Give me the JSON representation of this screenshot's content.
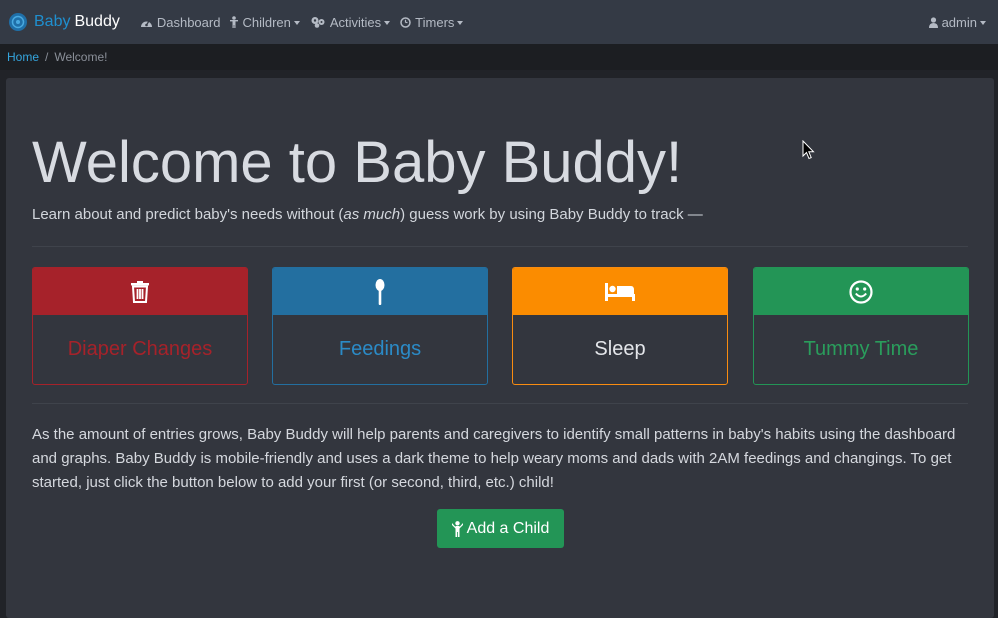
{
  "nav": {
    "brand_first": "Baby",
    "brand_second": "Buddy",
    "items": [
      {
        "label": "Dashboard",
        "icon": "dashboard-icon"
      },
      {
        "label": "Children",
        "icon": "child-icon"
      },
      {
        "label": "Activities",
        "icon": "activities-icon"
      },
      {
        "label": "Timers",
        "icon": "timer-icon"
      }
    ],
    "user": {
      "label": "admin",
      "icon": "user-icon"
    }
  },
  "breadcrumb": {
    "home": "Home",
    "separator": "/",
    "current": "Welcome!"
  },
  "main": {
    "title": "Welcome to Baby Buddy!",
    "lead_before": "Learn about and predict baby's needs without (",
    "lead_em": "as much",
    "lead_after": ") guess work by using Baby Buddy to track —",
    "cards": [
      {
        "label": "Diaper Changes",
        "icon": "trash-icon",
        "color": "#a6222a"
      },
      {
        "label": "Feedings",
        "icon": "spoon-icon",
        "color": "#236fa0"
      },
      {
        "label": "Sleep",
        "icon": "bed-icon",
        "color": "#fb8c00"
      },
      {
        "label": "Tummy Time",
        "icon": "smile-icon",
        "color": "#239556"
      }
    ],
    "body": "As the amount of entries grows, Baby Buddy will help parents and caregivers to identify small patterns in baby's habits using the dashboard and graphs. Baby Buddy is mobile-friendly and uses a dark theme to help weary moms and dads with 2AM feedings and changings. To get started, just click the button below to add your first (or second, third, etc.) child!",
    "add_button": "Add a Child"
  }
}
